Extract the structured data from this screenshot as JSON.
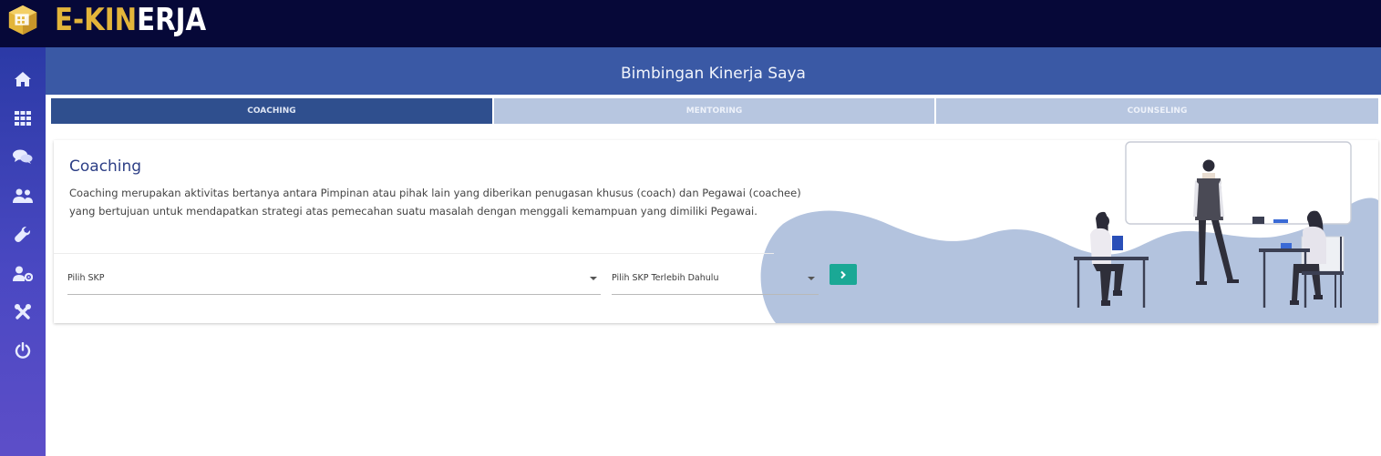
{
  "app": {
    "logo_prefix": "E-KIN",
    "logo_suffix": "ERJA",
    "brand_color": "#e3b53a",
    "accent_color": "#1aa895"
  },
  "sidebar": {
    "items": [
      {
        "icon": "home-icon"
      },
      {
        "icon": "grid-icon"
      },
      {
        "icon": "chat-icon"
      },
      {
        "icon": "users-icon"
      },
      {
        "icon": "wrench-icon"
      },
      {
        "icon": "user-settings-icon"
      },
      {
        "icon": "tools-icon"
      },
      {
        "icon": "power-icon"
      }
    ]
  },
  "header": {
    "title": "Bimbingan Kinerja Saya"
  },
  "tabs": [
    {
      "label": "COACHING",
      "active": true
    },
    {
      "label": "MENTORING",
      "active": false
    },
    {
      "label": "COUNSELING",
      "active": false
    }
  ],
  "card": {
    "title": "Coaching",
    "description": "Coaching merupakan aktivitas bertanya antara Pimpinan atau pihak lain yang diberikan penugasan khusus (coach) dan Pegawai (coachee) yang bertujuan untuk mendapatkan strategi atas pemecahan suatu masalah dengan menggali kemampuan yang dimiliki Pegawai.",
    "select_skp": "Pilih SKP",
    "select_second": "Pilih SKP Terlebih Dahulu",
    "go_icon": "chevron-right-icon"
  }
}
